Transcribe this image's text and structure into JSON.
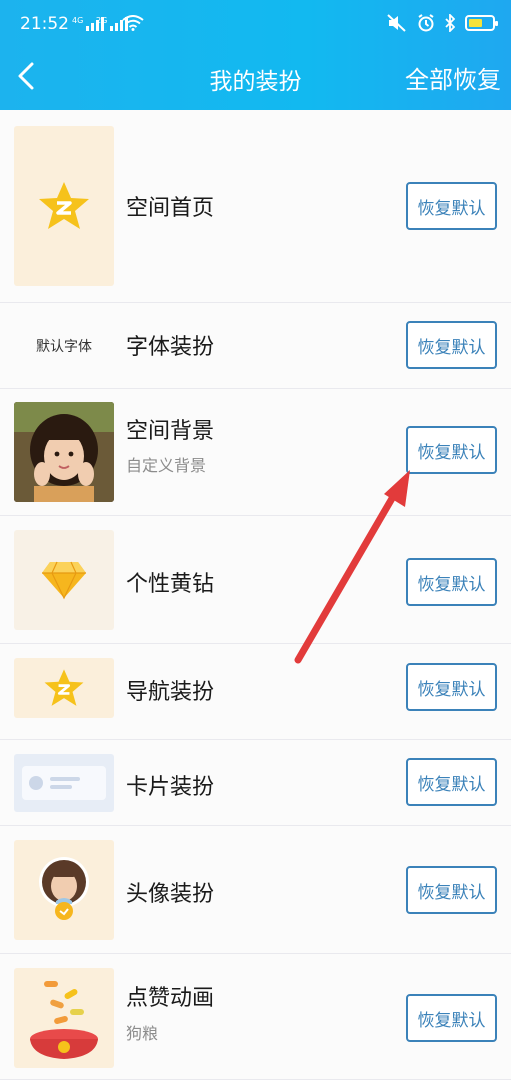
{
  "status": {
    "time": "21:52",
    "net1": "4G",
    "net2": "2G"
  },
  "nav": {
    "title": "我的装扮",
    "action": "全部恢复"
  },
  "button_label": "恢复默认",
  "font_thumb_text": "默认字体",
  "items": [
    {
      "title": "空间首页",
      "subtitle": ""
    },
    {
      "title": "字体装扮",
      "subtitle": ""
    },
    {
      "title": "空间背景",
      "subtitle": "自定义背景"
    },
    {
      "title": "个性黄钻",
      "subtitle": ""
    },
    {
      "title": "导航装扮",
      "subtitle": ""
    },
    {
      "title": "卡片装扮",
      "subtitle": ""
    },
    {
      "title": "头像装扮",
      "subtitle": ""
    },
    {
      "title": "点赞动画",
      "subtitle": "狗粮"
    }
  ],
  "colors": {
    "header": "#12b9f0",
    "button": "#3b82b9",
    "arrow": "#e23b3b",
    "star": "#f6c21b"
  }
}
